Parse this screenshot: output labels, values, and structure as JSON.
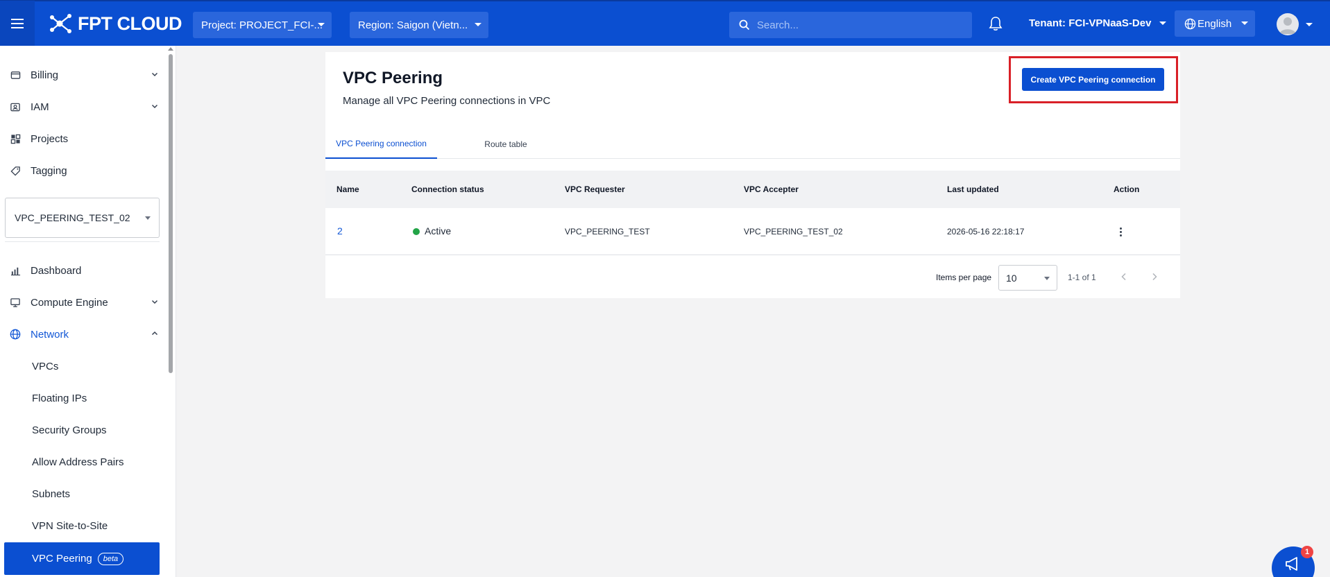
{
  "topbar": {
    "brand": "FPT CLOUD",
    "project_select": "Project: PROJECT_FCI-...",
    "region_select": "Region: Saigon (Vietn...",
    "search_placeholder": "Search...",
    "tenant": "Tenant: FCI-VPNaaS-Dev",
    "language": "English",
    "icons": [
      "menu-icon",
      "fpt-logo",
      "search-icon",
      "bell-icon",
      "globe-icon",
      "user-avatar"
    ]
  },
  "sidebar": {
    "top_items": [
      {
        "label": "Billing",
        "icon": "billing-icon",
        "expandable": true
      },
      {
        "label": "IAM",
        "icon": "iam-icon",
        "expandable": true
      },
      {
        "label": "Projects",
        "icon": "projects-icon",
        "expandable": false
      },
      {
        "label": "Tagging",
        "icon": "tag-icon",
        "expandable": false
      }
    ],
    "project_selector": "VPC_PEERING_TEST_02",
    "items": [
      {
        "label": "Dashboard",
        "icon": "chart-icon"
      },
      {
        "label": "Compute Engine",
        "icon": "monitor-icon"
      },
      {
        "label": "Network",
        "icon": "globe-icon",
        "expanded": true
      }
    ],
    "network_subitems": [
      {
        "label": "VPCs"
      },
      {
        "label": "Floating IPs"
      },
      {
        "label": "Security Groups"
      },
      {
        "label": "Allow Address Pairs"
      },
      {
        "label": "Subnets"
      },
      {
        "label": "VPN Site-to-Site"
      },
      {
        "label": "VPC Peering",
        "badge": "beta",
        "active": true
      }
    ]
  },
  "main": {
    "title": "VPC Peering",
    "subtitle": "Manage all VPC Peering connections in VPC",
    "create_button": "Create VPC Peering connection",
    "tabs": [
      {
        "label": "VPC Peering connection",
        "active": true
      },
      {
        "label": "Route table",
        "active": false
      }
    ],
    "table": {
      "columns": [
        "Name",
        "Connection status",
        "VPC Requester",
        "VPC Accepter",
        "Last updated",
        "Action"
      ],
      "rows": [
        {
          "name": "2",
          "status": "Active",
          "requester": "VPC_PEERING_TEST",
          "accepter": "VPC_PEERING_TEST_02",
          "updated": "2026-05-16 22:18:17"
        }
      ]
    },
    "pagination": {
      "items_per_page_label": "Items per page",
      "items_per_page": "10",
      "range": "1-1 of 1"
    }
  },
  "feedback": {
    "badge": "1"
  },
  "colors": {
    "primary": "#0b4fd1",
    "active_status": "#22a447",
    "highlight": "#d92027"
  }
}
